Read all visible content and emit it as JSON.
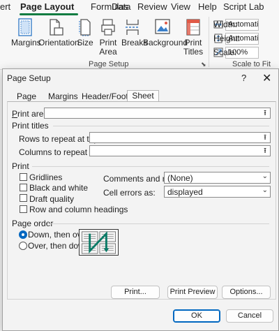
{
  "ribbon": {
    "tabs": [
      {
        "label": "ert"
      },
      {
        "label": "Page Layout"
      },
      {
        "label": "Formulas"
      },
      {
        "label": "Data"
      },
      {
        "label": "Review"
      },
      {
        "label": "View"
      },
      {
        "label": "Help"
      },
      {
        "label": "Script Lab"
      }
    ],
    "buttons": {
      "margins": "Margins",
      "orientation": "Orientation",
      "size": "Size",
      "print_area_line1": "Print",
      "print_area_line2": "Area",
      "breaks": "Breaks",
      "background": "Background",
      "print_titles_line1": "Print",
      "print_titles_line2": "Titles"
    },
    "group_page_setup": "Page Setup",
    "scale_to_fit": {
      "width_label": "Width:",
      "width_value": "Automatic",
      "height_label": "Height:",
      "height_value": "Automatic",
      "scale_label": "Scale:",
      "scale_value": "100%",
      "group_label": "Scale to Fit"
    }
  },
  "dialog": {
    "title": "Page Setup",
    "help": "?",
    "close": "✕",
    "tabs": [
      {
        "label": "Page"
      },
      {
        "label": "Margins"
      },
      {
        "label": "Header/Footer"
      },
      {
        "label": "Sheet"
      }
    ],
    "print_area_label": "Print area:",
    "print_titles_label": "Print titles",
    "rows_label": "Rows to repeat at top:",
    "columns_label": "Columns to repeat at left:",
    "print_section_label": "Print",
    "checks": {
      "gridlines": "Gridlines",
      "black_white": "Black and white",
      "draft_quality": "Draft quality",
      "row_col_headings": "Row and column headings"
    },
    "comments_label": "Comments and notes:",
    "comments_value": "(None)",
    "cell_errors_label": "Cell errors as:",
    "cell_errors_value": "displayed",
    "page_order_label": "Page order",
    "down_then_over": "Down, then over",
    "over_then_down": "Over, then down",
    "print_button": "Print...",
    "preview_button": "Print Preview",
    "options_button": "Options...",
    "ok_button": "OK",
    "cancel_button": "Cancel"
  },
  "colors": {
    "accent": "#0067c0",
    "excel_green": "#107c41"
  }
}
